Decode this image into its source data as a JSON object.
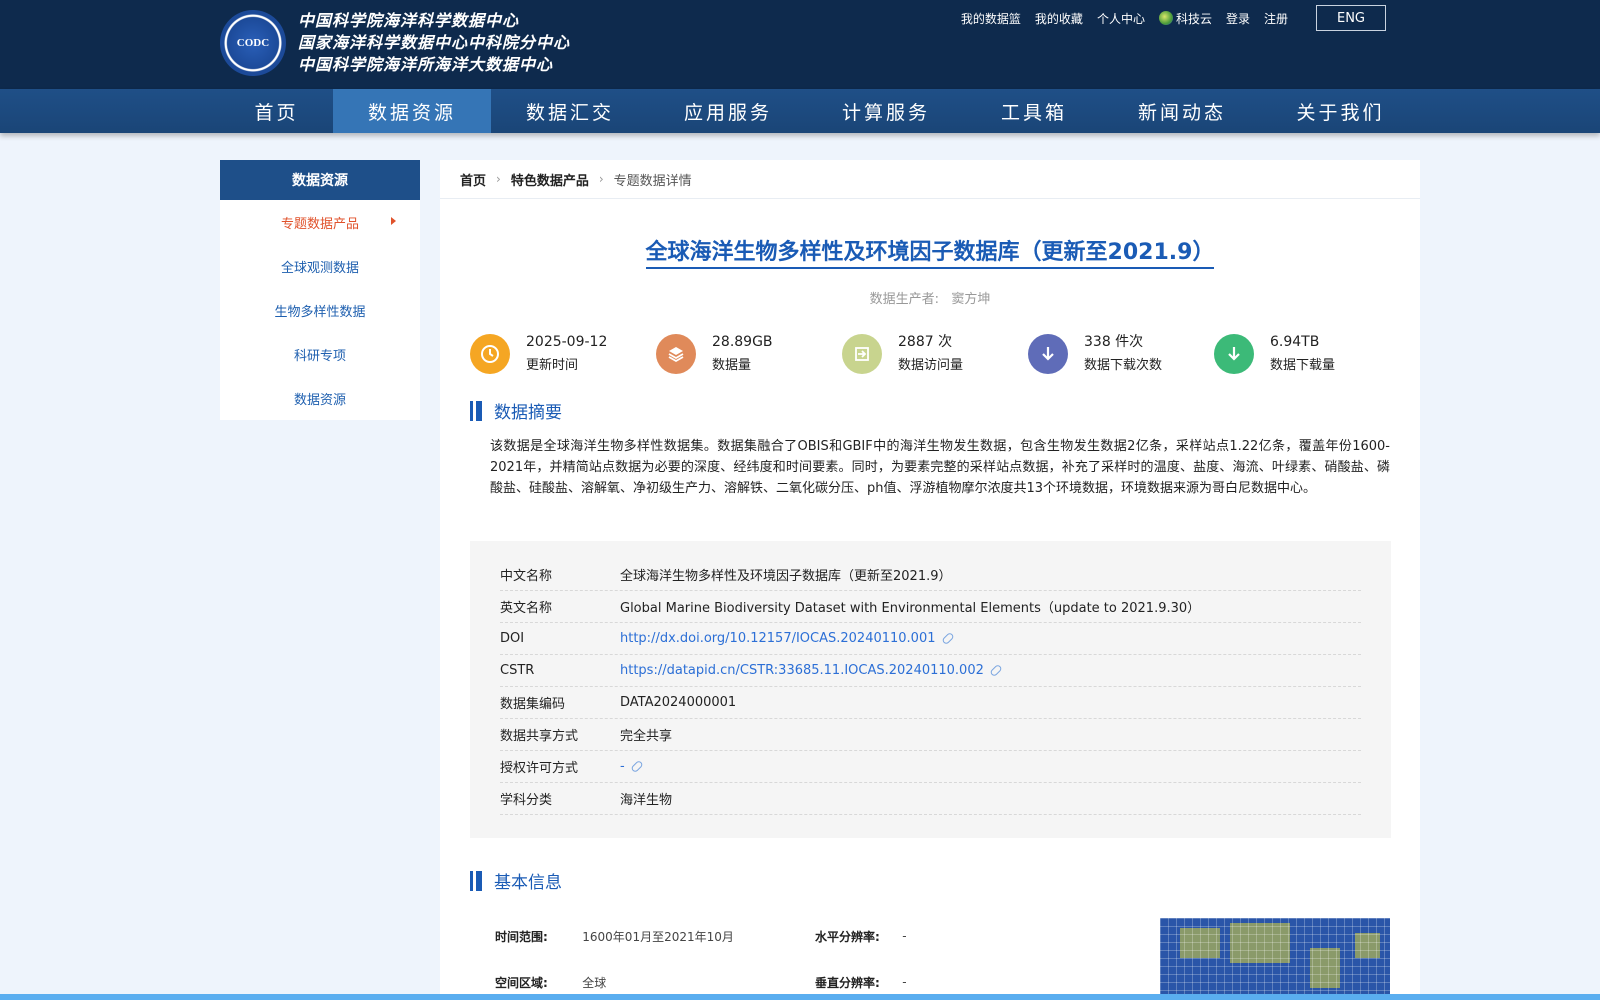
{
  "header": {
    "logo_text": "CODC",
    "org_names": [
      "中国科学院海洋科学数据中心",
      "国家海洋科学数据中心中科院分中心",
      "中国科学院海洋所海洋大数据中心"
    ],
    "top_links": [
      "我的数据篮",
      "我的收藏",
      "个人中心",
      "科技云",
      "登录",
      "注册"
    ],
    "lang_button": "ENG"
  },
  "nav": {
    "items": [
      "首页",
      "数据资源",
      "数据汇交",
      "应用服务",
      "计算服务",
      "工具箱",
      "新闻动态",
      "关于我们"
    ],
    "active": "数据资源"
  },
  "sidebar": {
    "title": "数据资源",
    "items": [
      "专题数据产品",
      "全球观测数据",
      "生物多样性数据",
      "科研专项",
      "数据资源"
    ]
  },
  "breadcrumb": [
    "首页",
    "特色数据产品",
    "专题数据详情"
  ],
  "dataset": {
    "title": "全球海洋生物多样性及环境因子数据库（更新至2021.9）",
    "producer_label": "数据生产者:",
    "producer": "窦方坤"
  },
  "stats": [
    {
      "value": "2025-09-12",
      "label": "更新时间",
      "color": "#f5a623",
      "icon": "clock-icon"
    },
    {
      "value": "28.89GB",
      "label": "数据量",
      "color": "#e08a5a",
      "icon": "layers-icon"
    },
    {
      "value": "2887 次",
      "label": "数据访问量",
      "color": "#c8d48e",
      "icon": "login-icon"
    },
    {
      "value": "338 件次",
      "label": "数据下载次数",
      "color": "#5f6cb8",
      "icon": "download-icon"
    },
    {
      "value": "6.94TB",
      "label": "数据下载量",
      "color": "#3cba78",
      "icon": "download-icon"
    }
  ],
  "abstract": {
    "heading": "数据摘要",
    "text": "该数据是全球海洋生物多样性数据集。数据集融合了OBIS和GBIF中的海洋生物发生数据，包含生物发生数据2亿条，采样站点1.22亿条，覆盖年份1600-2021年，并精简站点数据为必要的深度、经纬度和时间要素。同时，为要素完整的采样站点数据，补充了采样时的温度、盐度、海流、叶绿素、硝酸盐、磷酸盐、硅酸盐、溶解氧、净初级生产力、溶解铁、二氧化碳分压、ph值、浮游植物摩尔浓度共13个环境数据，环境数据来源为哥白尼数据中心。"
  },
  "info_table": [
    {
      "key": "中文名称",
      "value": "全球海洋生物多样性及环境因子数据库（更新至2021.9）",
      "link": false
    },
    {
      "key": "英文名称",
      "value": "Global Marine Biodiversity Dataset with Environmental Elements（update to 2021.9.30）",
      "link": false
    },
    {
      "key": "DOI",
      "value": "http://dx.doi.org/10.12157/IOCAS.20240110.001",
      "link": true
    },
    {
      "key": "CSTR",
      "value": "https://datapid.cn/CSTR:33685.11.IOCAS.20240110.002",
      "link": true
    },
    {
      "key": "数据集编码",
      "value": "DATA2024000001",
      "link": false
    },
    {
      "key": "数据共享方式",
      "value": "完全共享",
      "link": false
    },
    {
      "key": "授权许可方式",
      "value": " - ",
      "link": true
    },
    {
      "key": "学科分类",
      "value": "海洋生物",
      "link": false
    }
  ],
  "basic_info": {
    "heading": "基本信息",
    "rows": [
      {
        "k1": "时间范围:",
        "v1": "1600年01月至2021年10月",
        "k2": "水平分辨率:",
        "v2": "-"
      },
      {
        "k1": "空间区域:",
        "v1": "全球",
        "k2": "垂直分辨率:",
        "v2": "-"
      }
    ]
  }
}
